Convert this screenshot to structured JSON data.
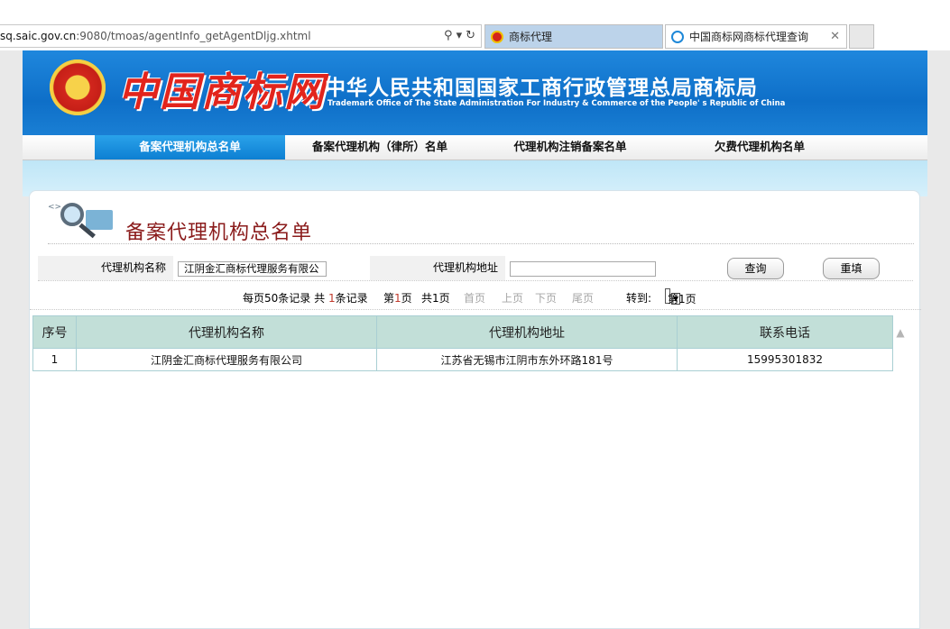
{
  "browser": {
    "url_prefix": "sq.saic.gov.cn",
    "url_rest": ":9080/tmoas/agentInfo_getAgentDljg.xhtml",
    "search_icon": "search-icon",
    "tabs": [
      {
        "label": "商标代理",
        "active": true
      },
      {
        "label": "中国商标网商标代理查询",
        "active": false
      }
    ],
    "close_glyph": "✕"
  },
  "banner": {
    "logo_text": "中国商标网",
    "org_cn": "中华人民共和国国家工商行政管理总局商标局",
    "org_en": "Trademark Office of The State Administration For Industry & Commerce of the People' s Republic of China"
  },
  "nav": {
    "items": [
      {
        "label": "备案代理机构总名单",
        "active": true
      },
      {
        "label": "备案代理机构（律所）名单",
        "active": false
      },
      {
        "label": "代理机构注销备案名单",
        "active": false
      },
      {
        "label": "欠费代理机构名单",
        "active": false
      }
    ]
  },
  "page": {
    "title": "备案代理机构总名单",
    "icon_tag": "<>"
  },
  "search": {
    "name_label": "代理机构名称",
    "name_value": "江阴金汇商标代理服务有限公",
    "address_label": "代理机构地址",
    "address_value": "",
    "query_button": "查询",
    "reset_button": "重填"
  },
  "pager": {
    "per_page_prefix": "每页",
    "per_page": "50",
    "per_page_suffix": "条记录 共",
    "total": "1",
    "total_suffix": "条记录",
    "current_prefix": "第",
    "current": "1",
    "current_suffix": "页",
    "pages_text": "共1页",
    "first": "首页",
    "prev": "上页",
    "next": "下页",
    "last": "尾页",
    "goto_label": "转到:",
    "goto_value": "第1页"
  },
  "table": {
    "headers": [
      "序号",
      "代理机构名称",
      "代理机构地址",
      "联系电话"
    ],
    "rows": [
      [
        "1",
        "江阴金汇商标代理服务有限公司",
        "江苏省无锡市江阴市东外环路181号",
        "15995301832"
      ]
    ]
  },
  "colors": {
    "accent_blue": "#0e6fc8",
    "title_red": "#8b1c1c",
    "table_header": "#c2dfd8"
  }
}
